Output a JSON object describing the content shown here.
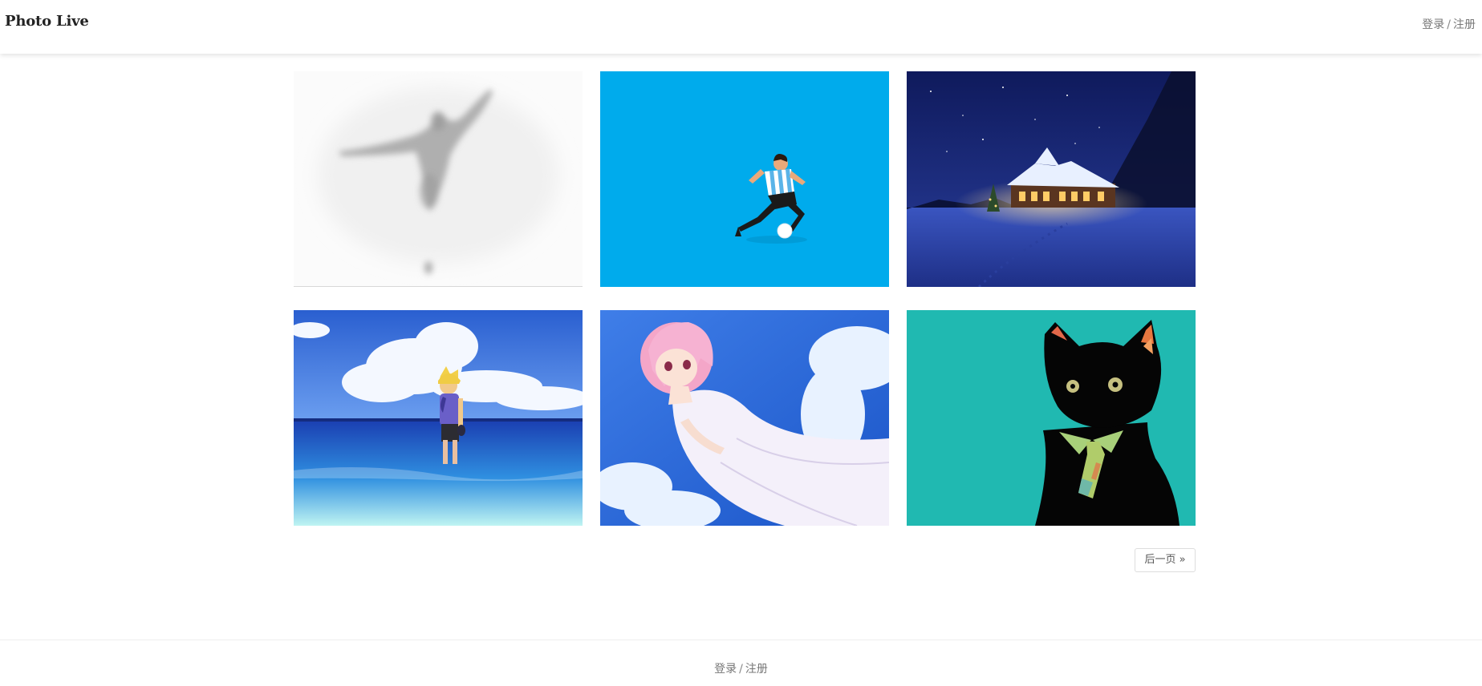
{
  "header": {
    "brand": "Photo Live",
    "login_label": "登录",
    "separator": "/",
    "register_label": "注册"
  },
  "gallery": {
    "photos": [
      {
        "subject": "blurred figure silhouette on white",
        "icon": "photo-thumbnail"
      },
      {
        "subject": "cartoon football player on blue",
        "icon": "photo-thumbnail"
      },
      {
        "subject": "snowy house at night",
        "icon": "photo-thumbnail"
      },
      {
        "subject": "anime boy at sea shore",
        "icon": "photo-thumbnail"
      },
      {
        "subject": "anime girl in white dress with sky",
        "icon": "photo-thumbnail"
      },
      {
        "subject": "black cat with tie on teal",
        "icon": "photo-thumbnail"
      }
    ]
  },
  "pagination": {
    "next_label": "后一页 »"
  },
  "footer": {
    "login_label": "登录",
    "separator": "/",
    "register_label": "注册"
  },
  "colors": {
    "header_bg": "#ffffff",
    "text_muted": "#777777",
    "football_bg": "#00a8e8",
    "night_sky": "#1b2a7a",
    "cat_bg": "#20b8b0"
  }
}
